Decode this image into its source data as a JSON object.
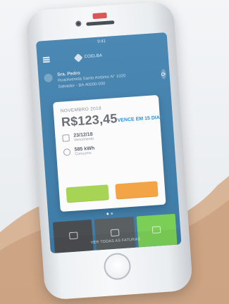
{
  "app": {
    "status_time": "9:41",
    "logo_text": "COELBA",
    "account": {
      "name": "Sra. Pedro",
      "line1": "Rua/Avenida Santo Antônio N° 1020",
      "line2": "Salvador - BA 40000-000"
    },
    "bill": {
      "month": "NOVEMBRO 2018",
      "amount": "R$123,45",
      "due_status": "VENCE EM 15 DIAS",
      "due_date": "23/12/18",
      "due_label": "Vencimento",
      "consumption": "585 kWh",
      "consumption_label": "Consumo",
      "buttons": {
        "pay": "",
        "details": ""
      }
    },
    "tiles": [
      {
        "label": ""
      },
      {
        "label": ""
      },
      {
        "label": ""
      }
    ],
    "bottom_link": "VER TODAS AS FATURAS"
  },
  "colors": {
    "screen_blue": "#4b88b3",
    "accent_blue": "#2b8fd2",
    "button_green": "#a8d455",
    "button_orange": "#f2a446",
    "tile_green": "#7bcf57"
  },
  "icons": {
    "menu": "menu-icon",
    "calendar": "calendar-icon",
    "bulb": "lightbulb-icon",
    "action": "share-icon",
    "home": "home-button"
  }
}
